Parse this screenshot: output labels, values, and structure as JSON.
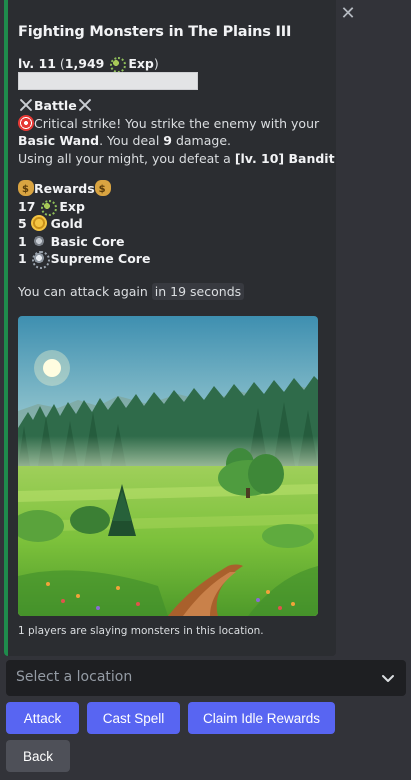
{
  "embed": {
    "accent_color": "#1f8b4c",
    "title": "Fighting Monsters in The Plains III",
    "level_prefix": "lv. 11",
    "level_paren_open": "(",
    "level_exp_value": "1,949",
    "level_exp_label": "Exp",
    "level_paren_close": ")",
    "exp_progress_fraction": 0,
    "battle": {
      "header": "Battle",
      "line1": "Critical strike! You strike the enemy with your",
      "weapon": "Basic Wand",
      "line2_mid": ". You deal ",
      "damage": "9",
      "line2_end": " damage.",
      "line3_start": "Using all your might, you defeat a ",
      "enemy": "[lv. 10] Bandit"
    },
    "rewards": {
      "header": "Rewards",
      "items": [
        {
          "qty": "17",
          "icon": "exp-icon",
          "name": "Exp"
        },
        {
          "qty": "5",
          "icon": "gold-coin-icon",
          "name": "Gold"
        },
        {
          "qty": "1",
          "icon": "basic-core-icon",
          "name": "Basic Core"
        },
        {
          "qty": "1",
          "icon": "supreme-core-icon",
          "name": "Supreme Core"
        }
      ]
    },
    "cooldown_text": "You can attack again",
    "cooldown_value": "in 19 seconds",
    "footer": "1 players are slaying monsters in this location."
  },
  "select": {
    "placeholder": "Select a location"
  },
  "buttons": {
    "attack": "Attack",
    "cast_spell": "Cast Spell",
    "claim_idle": "Claim Idle Rewards",
    "back": "Back"
  },
  "colors": {
    "primary_button": "#5865f2",
    "secondary_button": "#4e5058",
    "background": "#323339",
    "embed_background": "#2b2d31"
  }
}
